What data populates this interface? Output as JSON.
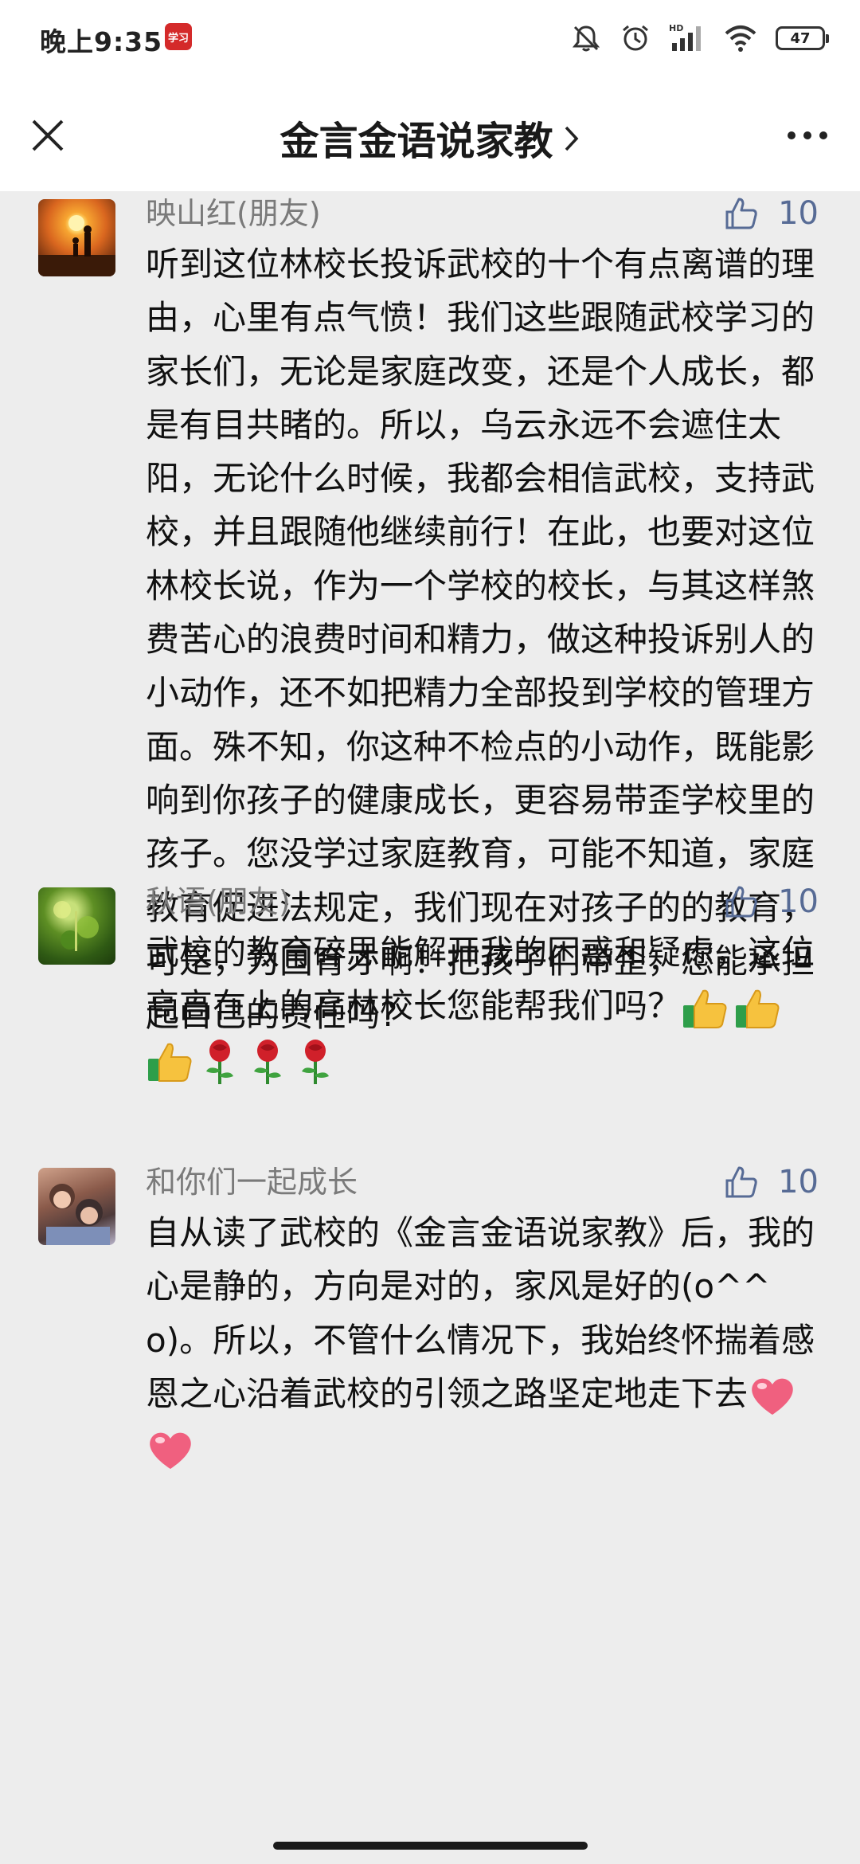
{
  "status_bar": {
    "time": "晚上9:35",
    "app_icon_label": "学习",
    "battery": "47",
    "icons": [
      "mute-icon",
      "alarm-icon",
      "hd-signal-icon",
      "wifi-icon",
      "battery-icon"
    ]
  },
  "header": {
    "title": "金言金语说家教",
    "close_icon": "close-icon",
    "more_icon": "more-icon"
  },
  "comments": [
    {
      "author": "映山红(朋友)",
      "likes": "10",
      "text": "听到这位林校长投诉武校的十个有点离谱的理由，心里有点气愤！我们这些跟随武校学习的家长们，无论是家庭改变，还是个人成长，都是有目共睹的。所以，乌云永远不会遮住太阳，无论什么时候，我都会相信武校，支持武校，并且跟随他继续前行！在此，也要对这位林校长说，作为一个学校的校长，与其这样煞费苦心的浪费时间和精力，做这种投诉别人的小动作，还不如把精力全部投到学校的管理方面。殊不知，你这种不检点的小动作，既能影响到你孩子的健康成长，更容易带歪学校里的孩子。您没学过家庭教育，可能不知道，家庭教育促进法规定，我们现在对孩子的的教育，可是，为国育才啊！把孩子们带歪，您能承担起自己的责任吗?"
    },
    {
      "author": "秋语(朋友)",
      "likes": "10",
      "text": "武校的教育碎思能解开我的困惑和疑虑，这位高高在上的高林校长您能帮我们吗？",
      "emojis": [
        "thumbs-up-emoji",
        "thumbs-up-emoji",
        "thumbs-up-emoji",
        "rose-emoji",
        "rose-emoji",
        "rose-emoji"
      ]
    },
    {
      "author": "和你们一起成长",
      "likes": "10",
      "text": "自从读了武校的《金言金语说家教》后，我的心是静的，方向是对的，家风是好的(o^^o)。所以，不管什么情况下，我始终怀揣着感恩之心沿着武校的引领之路坚定地走下去",
      "emojis": [
        "heart-emoji",
        "heart-emoji"
      ]
    }
  ]
}
